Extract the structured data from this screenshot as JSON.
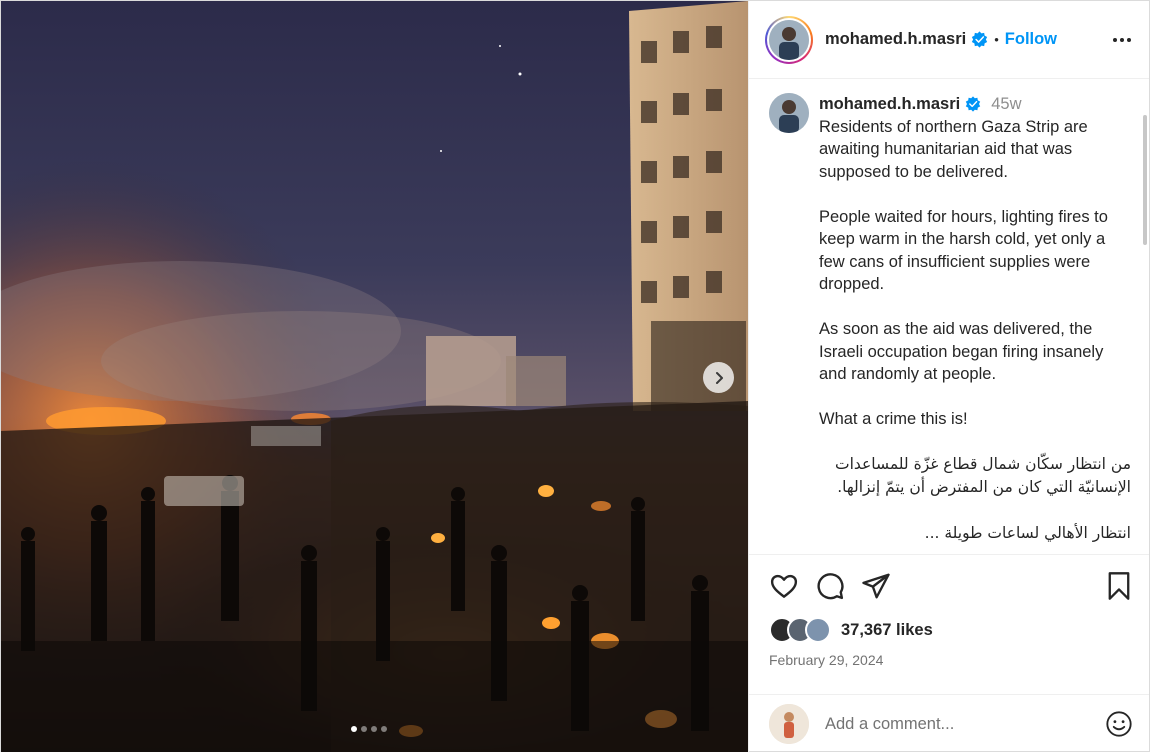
{
  "post": {
    "username": "mohamed.h.masri",
    "follow_label": "Follow",
    "separator": "•",
    "time_ago": "45w",
    "caption_paragraphs": [
      "Residents of northern Gaza Strip are awaiting humanitarian aid that was supposed to be delivered.",
      "People waited for hours, lighting fires to keep warm in the harsh cold, yet only a few cans of insufficient supplies were dropped.",
      "As soon as the aid was delivered, the Israeli occupation began firing insanely and randomly at people.",
      "What a crime this is!"
    ],
    "caption_arabic": "من انتظار سكّان شمال قطاع غزّة للمساعدات الإنسانيّة التي كان من المفترض أن يتمّ إنزالها.",
    "caption_arabic_cutoff": "انتظار الأهالي لساعات طويلة ...",
    "likes": "37,367 likes",
    "date": "February 29, 2024",
    "comment_placeholder": "Add a comment...",
    "carousel": {
      "slide_count": 4,
      "active_index": 0
    }
  },
  "icons": {
    "verified": "verified-badge-icon",
    "more": "more-options-icon",
    "like": "heart-icon",
    "comment": "comment-icon",
    "share": "share-icon",
    "save": "bookmark-icon",
    "next": "chevron-right-icon",
    "emoji": "emoji-icon"
  },
  "colors": {
    "link_blue": "#0095f6",
    "verified_blue": "#0095f6",
    "muted_text": "#8e8e8e"
  }
}
